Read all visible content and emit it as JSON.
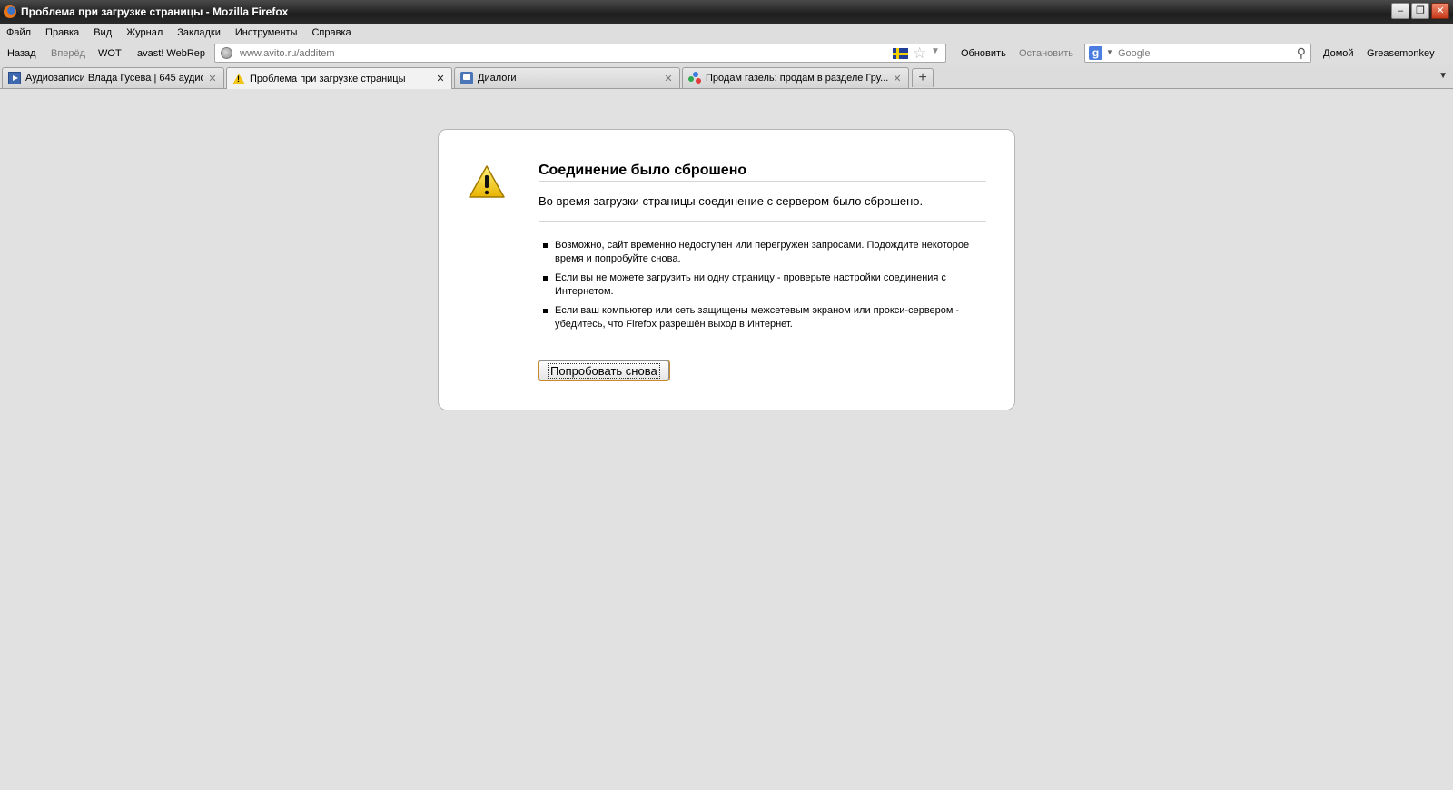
{
  "window": {
    "title": "Проблема при загрузке страницы - Mozilla Firefox",
    "controls": {
      "minimize": "‒",
      "maximize": "❐",
      "close": "✕"
    }
  },
  "menu": [
    "Файл",
    "Правка",
    "Вид",
    "Журнал",
    "Закладки",
    "Инструменты",
    "Справка"
  ],
  "nav": {
    "back": "Назад",
    "forward": "Вперёд",
    "wot": "WOT",
    "webrep": "avast! WebRep",
    "url_host": "www.avito.ru",
    "url_path": "/additem",
    "reload": "Обновить",
    "stop": "Остановить",
    "search_placeholder": "Google",
    "home": "Домой",
    "greasemonkey": "Greasemonkey"
  },
  "tabs": [
    {
      "title": "Аудиозаписи Влада Гусева | 645 аудио...",
      "icon": "audio-icon",
      "active": false
    },
    {
      "title": "Проблема при загрузке страницы",
      "icon": "warning-icon",
      "active": true
    },
    {
      "title": "Диалоги",
      "icon": "chat-icon",
      "active": false
    },
    {
      "title": "Продам газель: продам в разделе Гру...",
      "icon": "avito-icon",
      "active": false
    }
  ],
  "error": {
    "title": "Соединение было сброшено",
    "description": "Во время загрузки страницы соединение с сервером было сброшено.",
    "items": [
      "Возможно, сайт временно недоступен или перегружен запросами. Подождите некоторое время и попробуйте снова.",
      "Если вы не можете загрузить ни одну страницу - проверьте настройки соединения с Интернетом.",
      "Если ваш компьютер или сеть защищены межсетевым экраном или прокси-сервером - убедитесь, что Firefox разрешён выход в Интернет."
    ],
    "retry_label": "Попробовать снова"
  },
  "colors": {
    "page_bg": "#e1e1e1",
    "warning_yellow": "#f0c419",
    "titlebar_dark": "#1e1e1e"
  }
}
